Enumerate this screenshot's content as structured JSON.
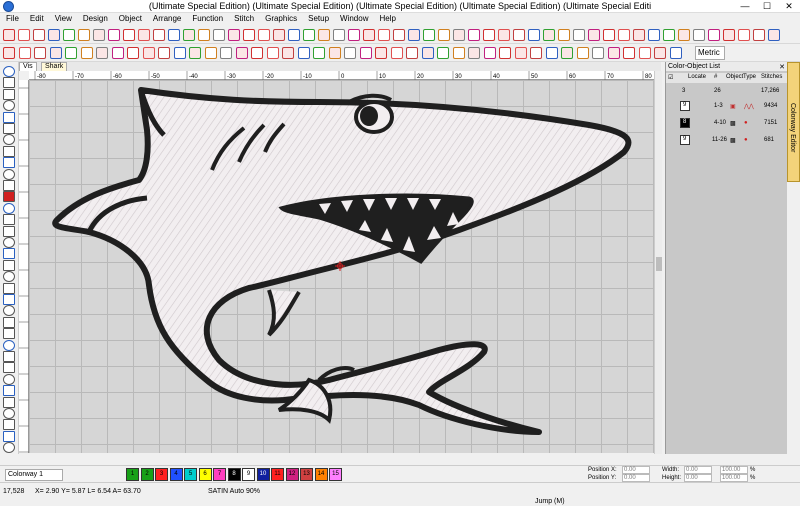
{
  "title": "(Ultimate Special Edition) (Ultimate Special Edition) (Ultimate Special Edition) (Ultimate Special Edition) (Ultimate Special Editi",
  "menu": [
    "File",
    "Edit",
    "View",
    "Design",
    "Object",
    "Arrange",
    "Function",
    "Stitch",
    "Graphics",
    "Setup",
    "Window",
    "Help"
  ],
  "toolbar": {
    "units": "Metric"
  },
  "tabs": [
    "Vis",
    "Shark"
  ],
  "ruler": {
    "top": [
      "-80",
      "-70",
      "-60",
      "-50",
      "-40",
      "-30",
      "-20",
      "-10",
      "0",
      "10",
      "20",
      "30",
      "40",
      "50",
      "60",
      "70",
      "80"
    ]
  },
  "panel": {
    "title": "Color-Object List",
    "headers": [
      "Locate",
      "#",
      "Object",
      "Type",
      "Stitches"
    ],
    "total_row": {
      "a": "3",
      "b": "26",
      "c": "17,266"
    },
    "rows": [
      {
        "num": "9",
        "range": "1-3",
        "stitches": "9434",
        "color": "#ffffff"
      },
      {
        "num": "8",
        "range": "4-10",
        "stitches": "7151",
        "color": "#000000"
      },
      {
        "num": "9",
        "range": "11-26",
        "stitches": "681",
        "color": "#ffffff"
      }
    ],
    "side_tab": "Colorway Editor"
  },
  "bottom": {
    "colorway": "Colorway 1",
    "swatches": [
      {
        "n": "1",
        "c": "#18a018"
      },
      {
        "n": "2",
        "c": "#18a018"
      },
      {
        "n": "3",
        "c": "#ff2020"
      },
      {
        "n": "4",
        "c": "#2050ff"
      },
      {
        "n": "5",
        "c": "#00cccc"
      },
      {
        "n": "6",
        "c": "#ffff00"
      },
      {
        "n": "7",
        "c": "#ff40c0"
      },
      {
        "n": "8",
        "c": "#000000"
      },
      {
        "n": "9",
        "c": "#ffffff"
      },
      {
        "n": "10",
        "c": "#1020a0"
      },
      {
        "n": "11",
        "c": "#ff2020"
      },
      {
        "n": "12",
        "c": "#d02080"
      },
      {
        "n": "13",
        "c": "#d04040"
      },
      {
        "n": "14",
        "c": "#ff8000"
      },
      {
        "n": "15",
        "c": "#ff80ff"
      }
    ],
    "pos_x_label": "Position X:",
    "pos_y_label": "Position Y:",
    "width_label": "Width:",
    "height_label": "Height:",
    "pos_x": "0.00",
    "pos_y": "0.00",
    "width": "0.00",
    "height": "0.00",
    "pct1": "100.00",
    "pct2": "100.00",
    "pct_sign": "%"
  },
  "status": {
    "count": "17,528",
    "coords": "X= 2.90 Y= 5.87 L= 6.54 A= 63.70",
    "mode": "SATIN Auto 90%",
    "jump": "Jump (M)"
  }
}
